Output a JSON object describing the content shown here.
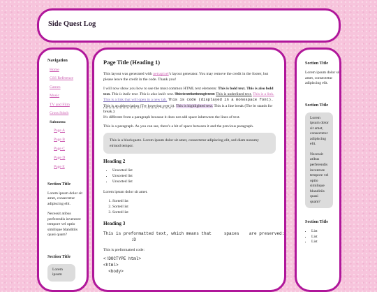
{
  "site_title": "Side Quest Log",
  "left_nav": {
    "heading": "Navigation",
    "items": [
      "Home",
      "CSS Reference",
      "Games",
      "Music",
      "TV and Film",
      "Cross Stitch"
    ],
    "submenu_label": "Submenu",
    "subitems": [
      "Page A",
      "Page B",
      "Page C",
      "Page D",
      "Page E"
    ],
    "section_heading": "Section Title",
    "section_text": [
      "Lorem ipsum dolor sit amet, consectetur adipiscing elit.",
      "Necessit atibus perferendis inventore tempore vel optio similique blanditiis quasi quam?"
    ],
    "section2_heading": "Section Title",
    "section2_box_text": "Lorem ipsum"
  },
  "main": {
    "title": "Page Title (Heading 1)",
    "intro": {
      "before_link": "This layout was generated with ",
      "link": "petrapixel",
      "after_link": "'s layout generator. You may remove the credit in the footer, but please leave the credit in the code. Thank you!"
    },
    "elements": {
      "lead": "I will now show you how to use the most common HTML text elements: ",
      "bold": "This is bold text.",
      "bold_also": "This is also bold text.",
      "italic": "This is italic text.",
      "italic_also": "This is also italic text.",
      "strike": "This is strikethrough text.",
      "underline": "This is underlined text.",
      "link": "This is a link.",
      "link_newtab": "This is a link that will open in a new tab.",
      "code": "This is code (displayed in a monospace font).",
      "abbr": "This is an abbreviation (Try hovering over it).",
      "highlight": "This is highlighted text.",
      "linebreak": "This is a line break (The br stands for break.):",
      "after_break": "It's different from a paragraph because it does not add space inbetween the lines of text."
    },
    "paragraph": "This is a paragraph. As you can see, there's a bit of space between it and the previous paragraph.",
    "blockquote": "This is a blockquote. Lorem ipsum dolor sit amet, consectetur adipiscing elit, sed diam nonumy eirmod tempor.",
    "heading2": "Heading 2",
    "unsorted": [
      "Unsorted list",
      "Unsorted list",
      "Unsorted list"
    ],
    "lorem": "Lorem ipsum dolor sit amet.",
    "sorted": [
      "Sorted list",
      "Sorted list",
      "Sorted list"
    ],
    "heading3": "Heading 3",
    "preformatted": "This is preformatted text, which means that     spaces    are preserved:\n           :D",
    "preformatted_code_label": "This is preformatted code:",
    "code_block": "<!DOCTYPE html>\n<html>\n  <body>"
  },
  "right_col": {
    "section1_heading": "Section Title",
    "section1_text": "Lorem ipsum dolor sit amet, consectetur adipiscing elit.",
    "section2_heading": "Section Title",
    "section2_box": [
      "Lorem ipsum dolor sit amet, consectetur adipiscing elit.",
      "Necessit atibus perferendis inventore tempore vel optio similique blanditiis quasi quam?"
    ],
    "section3_heading": "Section Title",
    "list": [
      "List",
      "List",
      "List"
    ]
  },
  "colors": {
    "border": "#b0169a",
    "link": "#cc5db0",
    "background": "#f7c4dc"
  }
}
